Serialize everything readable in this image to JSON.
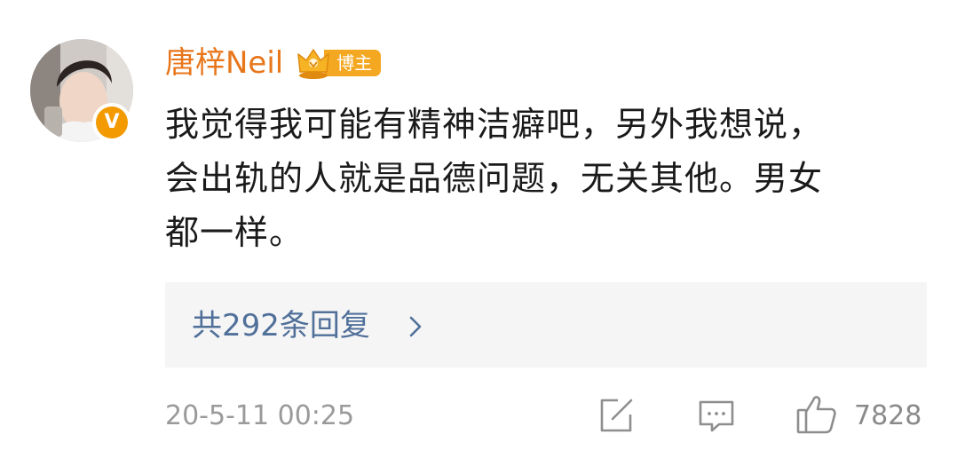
{
  "comment": {
    "username": "唐梓Neil",
    "badge_label": "博主",
    "verified_icon": "verified-v-icon",
    "avatar": "user-avatar-photo",
    "text_lines": [
      "我觉得我可能有精神洁癖吧，另外我想说，",
      "会出轨的人就是品德问题，无关其他。男女",
      "都一样。"
    ],
    "replies_label": "共292条回复",
    "timestamp": "20-5-11 00:25",
    "like_count": "7828"
  },
  "icons": {
    "share": "share-icon",
    "comment": "comment-icon",
    "like": "thumbs-up-icon",
    "chevron": "chevron-right-icon",
    "crown": "crown-badge-icon"
  },
  "colors": {
    "username": "#e8761b",
    "badge": "#f4a720",
    "verified": "#f39a00",
    "reply_link": "#50709a",
    "meta_text": "#9a9a9a",
    "reply_box_bg": "#f5f5f5"
  }
}
